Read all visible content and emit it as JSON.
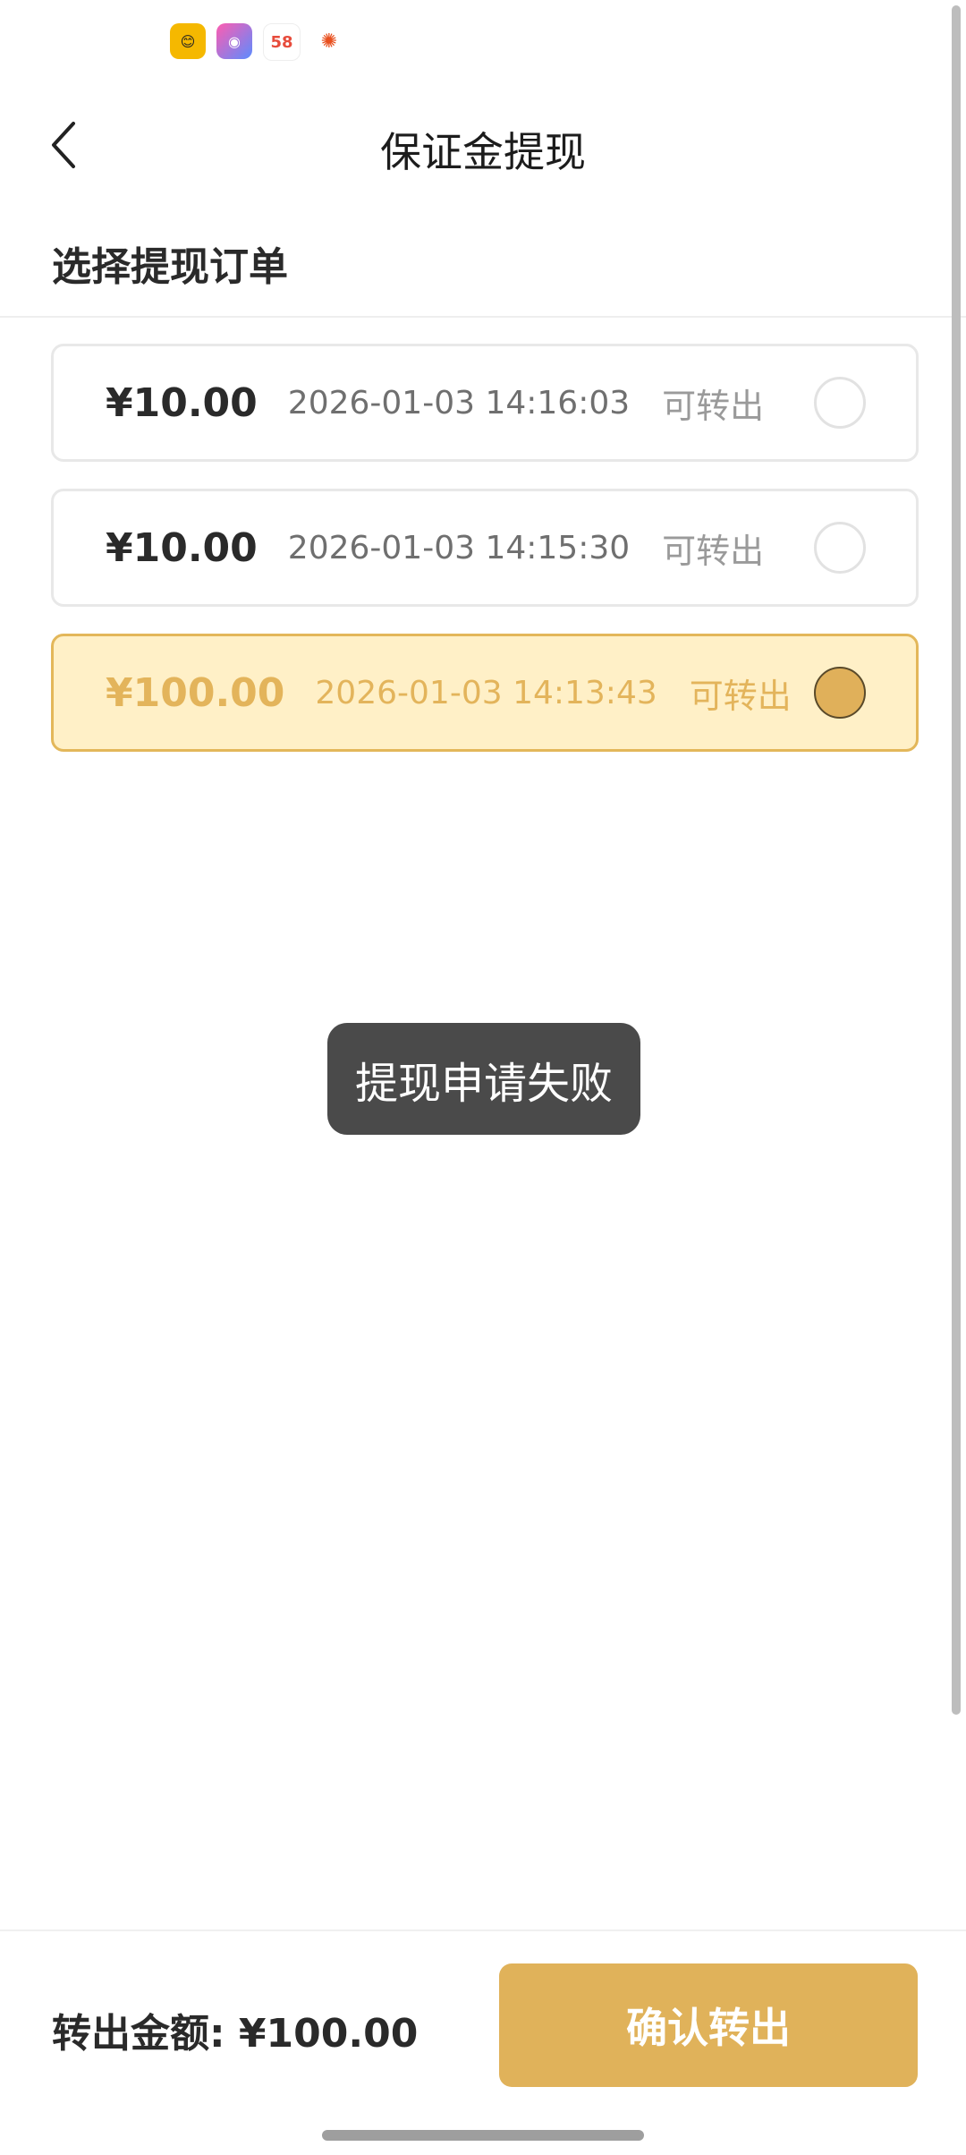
{
  "status_bar": {
    "icons": [
      {
        "name": "yellow-app-icon",
        "glyph": "😊"
      },
      {
        "name": "camera-app-icon",
        "glyph": "◉"
      },
      {
        "name": "58-app-icon",
        "glyph": "58"
      },
      {
        "name": "orange-app-icon",
        "glyph": "✺"
      }
    ]
  },
  "header": {
    "title": "保证金提现"
  },
  "section": {
    "label": "选择提现订单"
  },
  "orders": [
    {
      "amount": "¥10.00",
      "time": "2026-01-03 14:16:03",
      "status": "可转出",
      "selected": false
    },
    {
      "amount": "¥10.00",
      "time": "2026-01-03 14:15:30",
      "status": "可转出",
      "selected": false
    },
    {
      "amount": "¥100.00",
      "time": "2026-01-03 14:13:43",
      "status": "可转出",
      "selected": true
    }
  ],
  "toast": {
    "message": "提现申请失败"
  },
  "footer": {
    "transfer_amount": "转出金额: ¥100.00",
    "confirm_label": "确认转出"
  },
  "colors": {
    "accent": "#e0b25a",
    "selected_bg": "#fff0c7",
    "toast_bg": "#4a4a4a"
  }
}
